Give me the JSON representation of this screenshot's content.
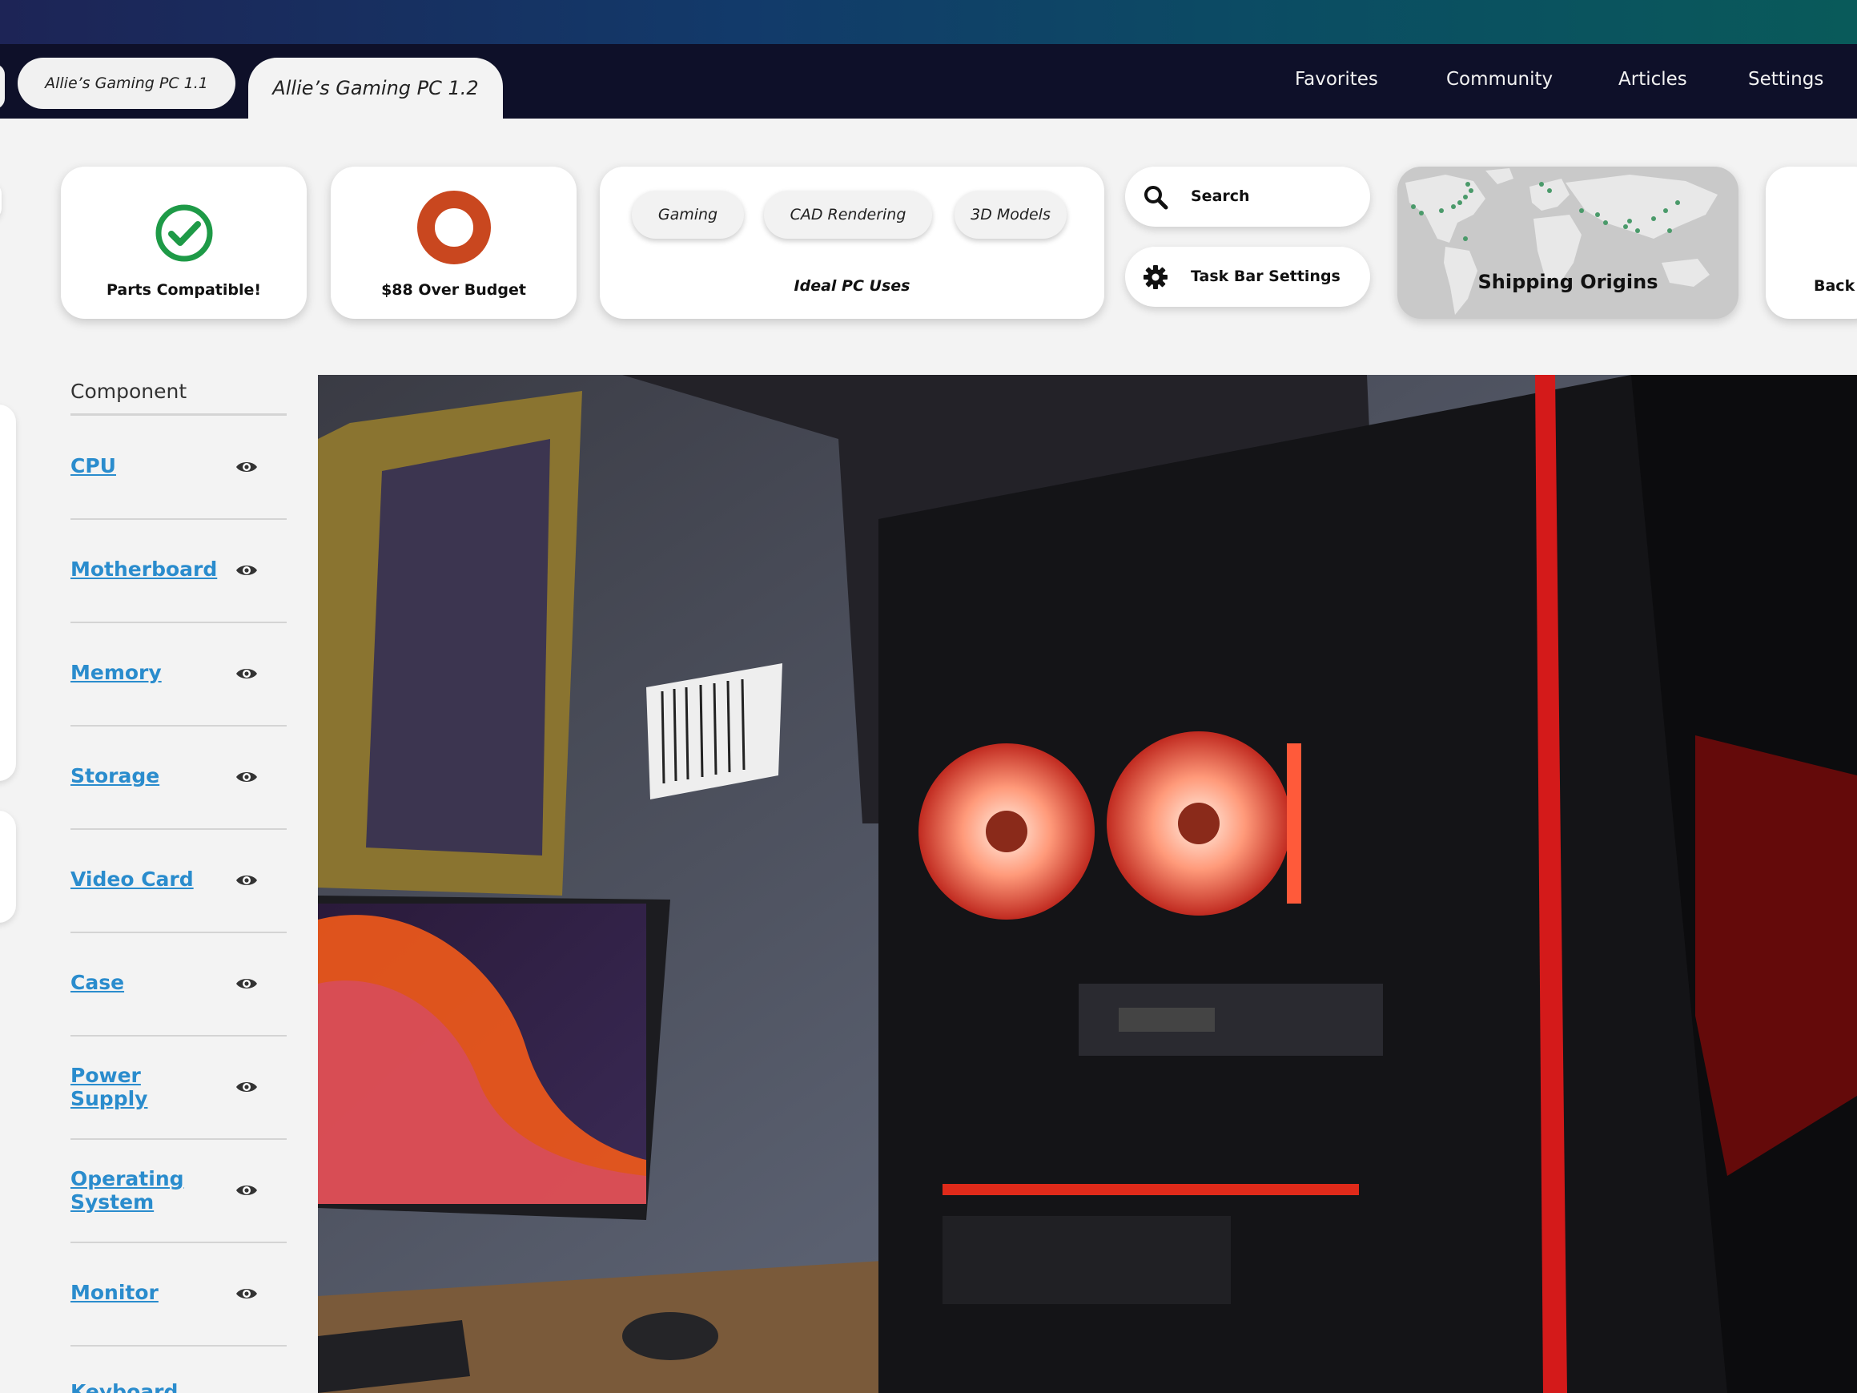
{
  "tabs": [
    {
      "label": "Allie’s Gaming PC 1.1",
      "active": false
    },
    {
      "label": "Allie’s Gaming PC 1.2",
      "active": true
    }
  ],
  "nav": {
    "favorites": "Favorites",
    "community": "Community",
    "articles": "Articles",
    "settings": "Settings"
  },
  "cards": {
    "compatible": {
      "label": "Parts Compatible!",
      "icon": "check-circle-icon",
      "color": "#1e9a47"
    },
    "budget": {
      "label": "$88 Over Budget",
      "icon": "ring-icon",
      "color": "#c9471f"
    },
    "uses": {
      "tags": [
        "Gaming",
        "CAD Rendering",
        "3D Models"
      ],
      "label": "Ideal PC Uses"
    },
    "search": {
      "label": "Search",
      "icon": "search-icon"
    },
    "taskbar": {
      "label": "Task Bar Settings",
      "icon": "gear-icon"
    },
    "shipping": {
      "label": "Shipping Origins",
      "map_dot_color": "#4a9a6a"
    },
    "back": {
      "label": "Back"
    }
  },
  "components": {
    "header": "Component",
    "items": [
      "CPU",
      "Motherboard",
      "Memory",
      "Storage",
      "Video Card",
      "Case",
      "Power Supply",
      "Operating System",
      "Monitor",
      "Keyboard"
    ]
  },
  "accent": "#2a8ccd"
}
